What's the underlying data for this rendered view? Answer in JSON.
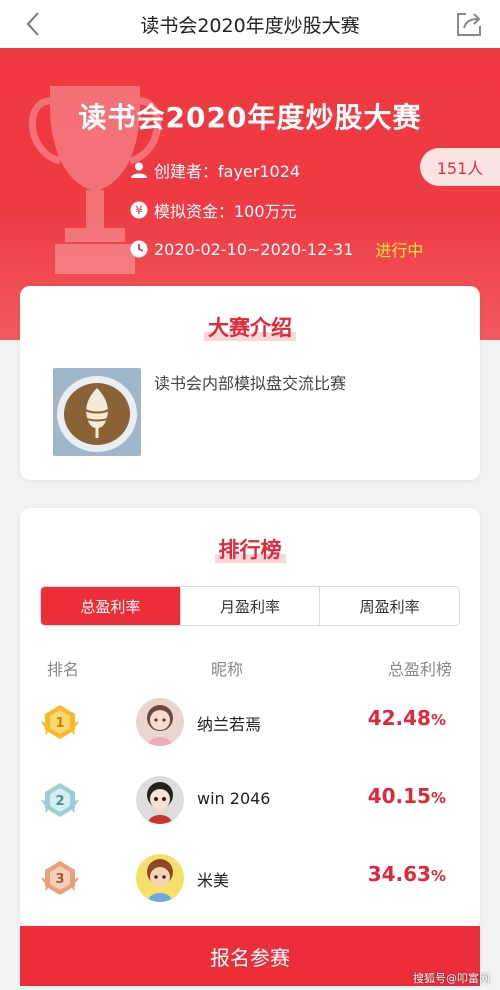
{
  "nav": {
    "title": "读书会2020年度炒股大赛",
    "back_icon": "chevron-left-icon",
    "share_icon": "share-icon"
  },
  "hero": {
    "title": "读书会2020年度炒股大赛",
    "creator": "创建者：fayer1024",
    "capital": "模拟资金：100万元",
    "period": "2020-02-10~2020-12-31",
    "status": "进行中",
    "participants": "151人",
    "status_color": "#ffe43b",
    "accent_color": "#ec2e3b"
  },
  "intro": {
    "title": "大赛介绍",
    "description": "读书会内部模拟盘交流比赛"
  },
  "ranking": {
    "title": "排行榜",
    "tabs": [
      "总盈利率",
      "月盈利率",
      "周盈利率"
    ],
    "active_tab": "总盈利率",
    "headers": {
      "rank": "排名",
      "nickname": "昵称",
      "profit": "总盈利榜"
    },
    "rows": [
      {
        "rank": "1",
        "name": "纳兰若焉",
        "value": "42.48",
        "unit": "%"
      },
      {
        "rank": "2",
        "name": "win 2046",
        "value": "40.15",
        "unit": "%"
      },
      {
        "rank": "3",
        "name": "米美",
        "value": "34.63",
        "unit": "%"
      }
    ]
  },
  "signup": {
    "label": "报名参赛"
  },
  "watermark": "搜狐号@叩富网"
}
